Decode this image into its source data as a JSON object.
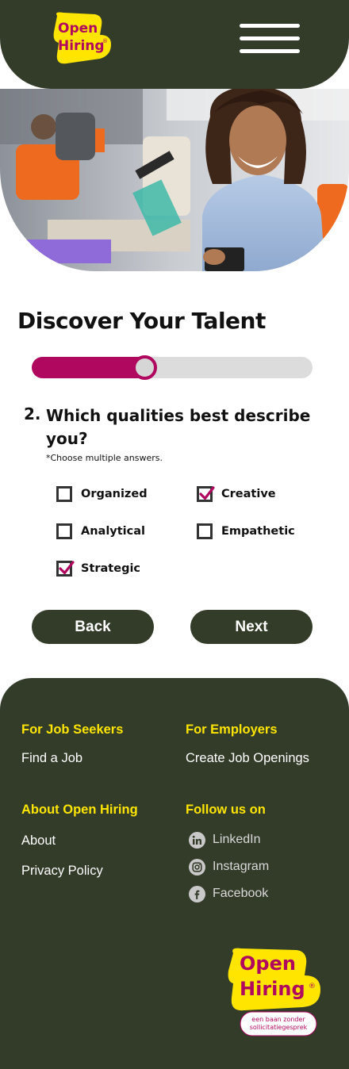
{
  "brand": {
    "line1": "Open",
    "line2": "Hiring",
    "registered": "®",
    "tagline_line1": "een baan zonder",
    "tagline_line2": "sollicitatiegesprek",
    "colors": {
      "yellow": "#ffe500",
      "magenta": "#b0075f",
      "dark": "#323c29"
    }
  },
  "header": {
    "menu_icon": "hamburger-menu-icon"
  },
  "quiz": {
    "title": "Discover Your Talent",
    "progress": 0.4,
    "question_number": "2.",
    "question_text": "Which qualities best describe you?",
    "hint": "*Choose multiple answers.",
    "options": [
      {
        "label": "Organized",
        "checked": false
      },
      {
        "label": "Creative",
        "checked": true
      },
      {
        "label": "Analytical",
        "checked": false
      },
      {
        "label": "Empathetic",
        "checked": false
      },
      {
        "label": "Strategic",
        "checked": true
      }
    ],
    "back_label": "Back",
    "next_label": "Next"
  },
  "footer": {
    "job_seekers": {
      "heading": "For Job Seekers",
      "links": [
        "Find a Job"
      ]
    },
    "employers": {
      "heading": "For Employers",
      "links": [
        "Create Job Openings"
      ]
    },
    "about": {
      "heading": "About Open Hiring",
      "links": [
        "About",
        "Privacy Policy"
      ]
    },
    "follow": {
      "heading": "Follow us on",
      "links": [
        {
          "label": "LinkedIn",
          "icon": "linkedin-icon"
        },
        {
          "label": "Instagram",
          "icon": "instagram-icon"
        },
        {
          "label": "Facebook",
          "icon": "facebook-icon"
        }
      ]
    }
  }
}
